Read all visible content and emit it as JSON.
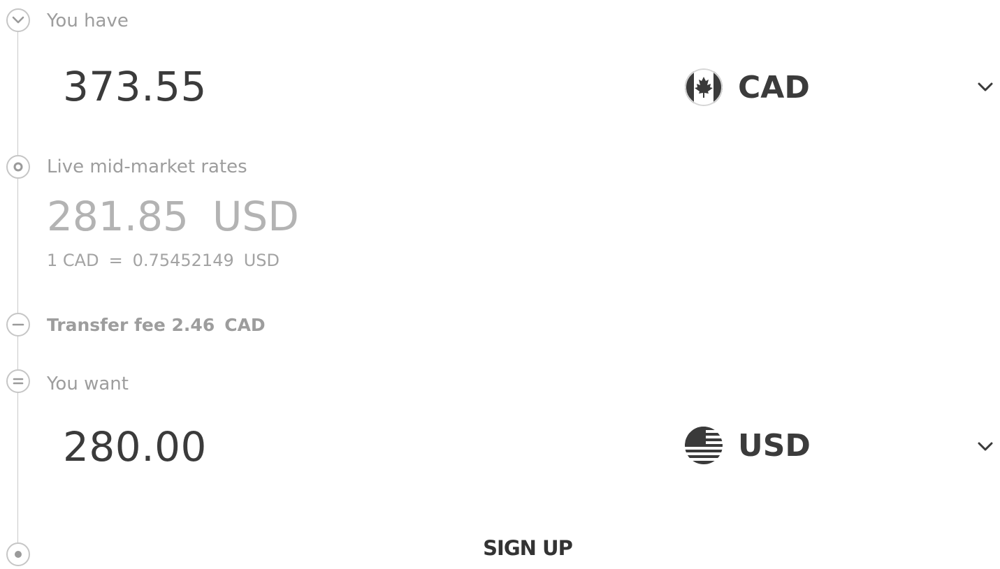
{
  "you_have": {
    "label": "You have",
    "amount": "373.55",
    "currency_code": "CAD",
    "flag": "canada-flag-icon"
  },
  "rate_info": {
    "label": "Live mid-market rates",
    "converted_amount": "281.85",
    "converted_currency": "USD",
    "rate_left": "1 CAD",
    "rate_equals": "=",
    "rate_value": "0.75452149",
    "rate_currency": "USD"
  },
  "fee": {
    "label": "Transfer fee 2.46",
    "currency": "CAD"
  },
  "you_want": {
    "label": "You want",
    "amount": "280.00",
    "currency_code": "USD",
    "flag": "usa-flag-icon"
  },
  "actions": {
    "signup_label": "SIGN UP"
  },
  "icons": {
    "step_have": "chevron-down-circle-icon",
    "step_rate": "dot-circle-icon",
    "step_fee": "minus-circle-icon",
    "step_want": "equals-circle-icon",
    "step_end": "dot-circle-icon",
    "dropdown": "chevron-down-icon"
  },
  "colors": {
    "amount_text": "#3b3b3b",
    "muted_text": "#9d9d9d",
    "line": "#c9c9c9",
    "canada_red": "#3a3a3a"
  }
}
